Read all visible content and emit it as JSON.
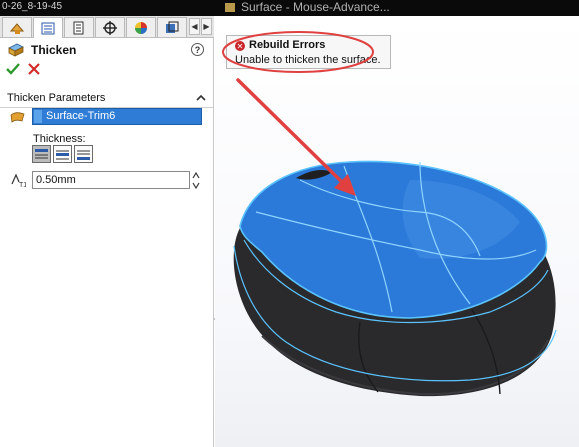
{
  "recording_stamp": "0-26_8-19-45",
  "document_title": "Surface - Mouse-Advance...",
  "property_manager": {
    "tabs": [
      {
        "name": "featuremanager-tab"
      },
      {
        "name": "propertymanager-tab"
      },
      {
        "name": "configurationmanager-tab"
      },
      {
        "name": "dimxpert-tab"
      },
      {
        "name": "display-manager-tab"
      },
      {
        "name": "cam-tab"
      }
    ],
    "feature_title": "Thicken",
    "section_title": "Thicken Parameters",
    "selected_surface": "Surface-Trim6",
    "thickness_label": "Thickness:",
    "thickness_value": "0.50mm"
  },
  "tooltip": {
    "title": "Rebuild Errors",
    "message": "Unable to thicken the surface."
  },
  "colors": {
    "accent_selection": "#2e7cd6",
    "error_red": "#c8262a",
    "annotation_red": "#e04040",
    "model_blue": "#2b79d8",
    "model_dark": "#2a2a2c",
    "edge_highlight": "#5bc3ff"
  },
  "icons": {
    "ok": "check-icon",
    "cancel": "close-icon",
    "help": "help-icon",
    "collapse": "chevron-up-icon",
    "error": "error-icon"
  }
}
